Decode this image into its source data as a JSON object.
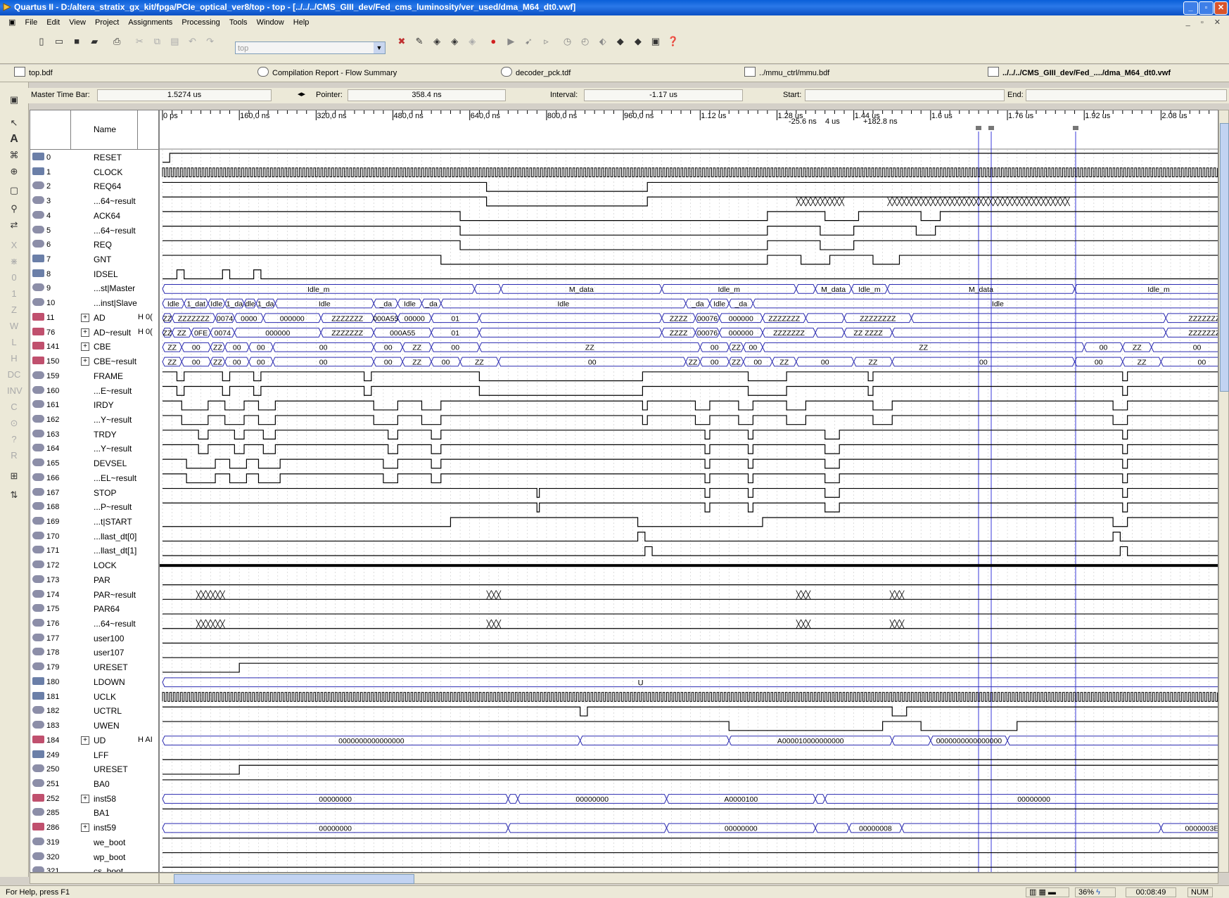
{
  "window": {
    "title": "Quartus II - D:/altera_stratix_gx_kit/fpga/PCIe_optical_ver8/top - top - [../../../CMS_GIII_dev/Fed_cms_luminosity/ver_used/dma_M64_dt0.vwf]"
  },
  "menu": [
    "File",
    "Edit",
    "View",
    "Project",
    "Assignments",
    "Processing",
    "Tools",
    "Window",
    "Help"
  ],
  "toolbar": {
    "project_combo": "top"
  },
  "doc_tabs": [
    {
      "label": "top.bdf"
    },
    {
      "label": "Compilation Report - Flow Summary"
    },
    {
      "label": "decoder_pck.tdf"
    },
    {
      "label": "../mmu_ctrl/mmu.bdf"
    },
    {
      "label": "../../../CMS_GIII_dev/Fed_..../dma_M64_dt0.vwf"
    }
  ],
  "timebar": {
    "master_label": "Master Time Bar:",
    "master_value": "1.5274 us",
    "pointer_label": "Pointer:",
    "pointer_value": "358.4 ns",
    "interval_label": "Interval:",
    "interval_value": "-1.17 us",
    "start_label": "Start:",
    "start_value": "",
    "end_label": "End:",
    "end_value": ""
  },
  "name_header": "Name",
  "time_ruler": [
    "0 ps",
    "160,0 ns",
    "320,0 ns",
    "480,0 ns",
    "640,0 ns",
    "800,0 ns",
    "960,0 ns",
    "1.12 us",
    "1.28 us",
    "1.44 us",
    "1.6 us",
    "1.76 us",
    "1.92 us",
    "2.08 us"
  ],
  "markers": {
    "m1": "-25.6 ns",
    "m2": "4 us",
    "m3": "+182.8 ns"
  },
  "signals": [
    {
      "id": "0",
      "name": "RESET",
      "pin": "in"
    },
    {
      "id": "1",
      "name": "CLOCK",
      "pin": "in"
    },
    {
      "id": "2",
      "name": "REQ64",
      "pin": "out"
    },
    {
      "id": "3",
      "name": "...64~result",
      "pin": "out"
    },
    {
      "id": "4",
      "name": "ACK64",
      "pin": "out"
    },
    {
      "id": "5",
      "name": "...64~result",
      "pin": "out"
    },
    {
      "id": "6",
      "name": "REQ",
      "pin": "out"
    },
    {
      "id": "7",
      "name": "GNT",
      "pin": "in"
    },
    {
      "id": "8",
      "name": "IDSEL",
      "pin": "in"
    },
    {
      "id": "9",
      "name": "...st|Master",
      "pin": "out"
    },
    {
      "id": "10",
      "name": "...inst|Slave",
      "pin": "out"
    },
    {
      "id": "11",
      "name": "AD",
      "pin": "bus",
      "expand": "+",
      "val": "H 0("
    },
    {
      "id": "76",
      "name": "AD~result",
      "pin": "bus",
      "expand": "+",
      "val": "H 0("
    },
    {
      "id": "141",
      "name": "CBE",
      "pin": "bus",
      "expand": "+",
      "val": ""
    },
    {
      "id": "150",
      "name": "CBE~result",
      "pin": "bus",
      "expand": "+",
      "val": ""
    },
    {
      "id": "159",
      "name": "FRAME",
      "pin": "out"
    },
    {
      "id": "160",
      "name": "...E~result",
      "pin": "out"
    },
    {
      "id": "161",
      "name": "IRDY",
      "pin": "out"
    },
    {
      "id": "162",
      "name": "...Y~result",
      "pin": "out"
    },
    {
      "id": "163",
      "name": "TRDY",
      "pin": "out"
    },
    {
      "id": "164",
      "name": "...Y~result",
      "pin": "out"
    },
    {
      "id": "165",
      "name": "DEVSEL",
      "pin": "out"
    },
    {
      "id": "166",
      "name": "...EL~result",
      "pin": "out"
    },
    {
      "id": "167",
      "name": "STOP",
      "pin": "out"
    },
    {
      "id": "168",
      "name": "...P~result",
      "pin": "out"
    },
    {
      "id": "169",
      "name": "...t|START",
      "pin": "out"
    },
    {
      "id": "170",
      "name": "...llast_dt[0]",
      "pin": "out"
    },
    {
      "id": "171",
      "name": "...llast_dt[1]",
      "pin": "out"
    },
    {
      "id": "172",
      "name": "LOCK",
      "pin": "out"
    },
    {
      "id": "173",
      "name": "PAR",
      "pin": "out"
    },
    {
      "id": "174",
      "name": "PAR~result",
      "pin": "out"
    },
    {
      "id": "175",
      "name": "PAR64",
      "pin": "out"
    },
    {
      "id": "176",
      "name": "...64~result",
      "pin": "out"
    },
    {
      "id": "177",
      "name": "user100",
      "pin": "out"
    },
    {
      "id": "178",
      "name": "user107",
      "pin": "out"
    },
    {
      "id": "179",
      "name": "URESET",
      "pin": "out"
    },
    {
      "id": "180",
      "name": "LDOWN",
      "pin": "in"
    },
    {
      "id": "181",
      "name": "UCLK",
      "pin": "in"
    },
    {
      "id": "182",
      "name": "UCTRL",
      "pin": "out"
    },
    {
      "id": "183",
      "name": "UWEN",
      "pin": "out"
    },
    {
      "id": "184",
      "name": "UD",
      "pin": "bus",
      "expand": "+",
      "val": "H AI"
    },
    {
      "id": "249",
      "name": "LFF",
      "pin": "in"
    },
    {
      "id": "250",
      "name": "URESET",
      "pin": "out"
    },
    {
      "id": "251",
      "name": "BA0",
      "pin": "out"
    },
    {
      "id": "252",
      "name": "inst58",
      "pin": "bus",
      "expand": "+",
      "val": ""
    },
    {
      "id": "285",
      "name": "BA1",
      "pin": "out"
    },
    {
      "id": "286",
      "name": "inst59",
      "pin": "bus",
      "expand": "+",
      "val": ""
    },
    {
      "id": "319",
      "name": "we_boot",
      "pin": "out"
    },
    {
      "id": "320",
      "name": "wp_boot",
      "pin": "out"
    },
    {
      "id": "321",
      "name": "cs_boot",
      "pin": "out"
    }
  ],
  "bus_labels": {
    "master": [
      "Idle_m",
      "M_data",
      "Idle_m",
      "M_data",
      "Idle_m",
      "M_data",
      "Idle_m"
    ],
    "slave": [
      "Idle",
      "1_dat",
      "Idle",
      "1_da",
      "dle",
      "1_da",
      "Idle",
      "_da",
      "Idle",
      "_da",
      "Idle",
      "_da",
      "Idle",
      "_da",
      "Idle"
    ],
    "ad": [
      "ZZ",
      "ZZZZZZZ",
      "0074",
      "0000",
      "00000",
      "ZZZZZZZ",
      "000A55",
      "ZZ",
      "00000",
      "ZZ",
      "01",
      "ZZZ",
      "ZZZZ",
      "00076",
      "ZZ",
      "00000",
      "ZZZZZZZ",
      "ZZZZZZZZ",
      "ZZZZZZZ"
    ],
    "ad_res": [
      "ZZ",
      "ZZ",
      "0FE",
      "0074",
      "00000",
      "ZZZZZZZ",
      "000A55",
      "ZZ",
      "00000",
      "ZZ",
      "01",
      "ZZZZ",
      "ZZZZ",
      "00076",
      "ZZ",
      "00000",
      "ZZZZZZZ",
      "ZZ",
      "ZZZZ",
      "ZZZZZZZ"
    ],
    "cbe": [
      "ZZ",
      "00",
      "ZZ",
      "00",
      "00",
      "00",
      "00",
      "ZZ",
      "00",
      "ZZ",
      "00",
      "00",
      "ZZ",
      "00",
      "ZZ",
      "00"
    ],
    "cbe_res": [
      "ZZ",
      "00",
      "ZZ",
      "00",
      "00",
      "00",
      "00",
      "ZZ",
      "00",
      "ZZ",
      "00",
      "ZZ",
      "00",
      "00",
      "ZZ",
      "00",
      "ZZ",
      "00",
      "ZZ",
      "00",
      "00",
      "00"
    ],
    "ldown": "U",
    "ud": [
      "0000000000000000",
      "A000010000000000",
      "0000000000000000"
    ],
    "inst58": [
      "00000000",
      "00000000",
      "A0000100",
      "00000000"
    ],
    "inst59": [
      "00000000",
      "00000000",
      "00000008",
      "0000003E"
    ]
  },
  "status": {
    "help": "For Help, press F1",
    "zoom": "36%",
    "time": "00:08:49",
    "num": "NUM"
  }
}
